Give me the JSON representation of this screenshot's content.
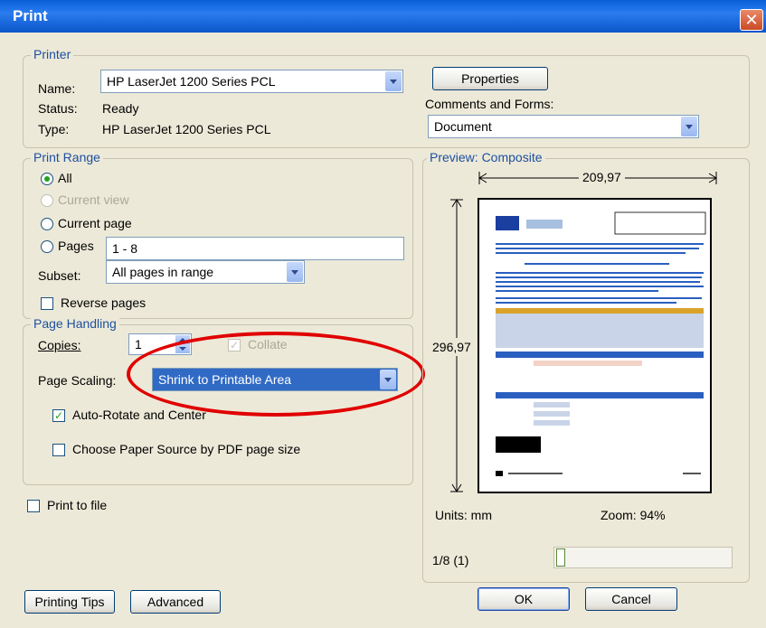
{
  "window": {
    "title": "Print",
    "close_glyph": "✕"
  },
  "printer": {
    "group_label": "Printer",
    "name_label": "Name:",
    "name_value": "HP LaserJet 1200 Series PCL",
    "status_label": "Status:",
    "status_value": "Ready",
    "type_label": "Type:",
    "type_value": "HP LaserJet 1200 Series PCL",
    "properties_button": "Properties",
    "comments_label": "Comments and Forms:",
    "comments_value": "Document"
  },
  "print_range": {
    "group_label": "Print Range",
    "all": "All",
    "current_view": "Current view",
    "current_page": "Current page",
    "pages": "Pages",
    "pages_value": "1 - 8",
    "subset_label": "Subset:",
    "subset_value": "All pages in range",
    "reverse_pages": "Reverse pages"
  },
  "page_handling": {
    "group_label": "Page Handling",
    "copies_label": "Copies:",
    "copies_value": "1",
    "collate": "Collate",
    "scaling_label": "Page Scaling:",
    "scaling_value": "Shrink to Printable Area",
    "auto_rotate": "Auto-Rotate and Center",
    "choose_paper": "Choose Paper Source by PDF page size"
  },
  "print_to_file": "Print to file",
  "preview": {
    "group_label": "Preview: Composite",
    "width": "209,97",
    "height": "296,97",
    "units": "Units: mm",
    "zoom": "Zoom:  94%",
    "page_counter": "1/8 (1)"
  },
  "buttons": {
    "printing_tips": "Printing Tips",
    "advanced": "Advanced",
    "ok": "OK",
    "cancel": "Cancel"
  },
  "colors": {
    "title_bar": "#0a5fd8",
    "highlight": "#316ac5",
    "annotation": "#e00000"
  }
}
